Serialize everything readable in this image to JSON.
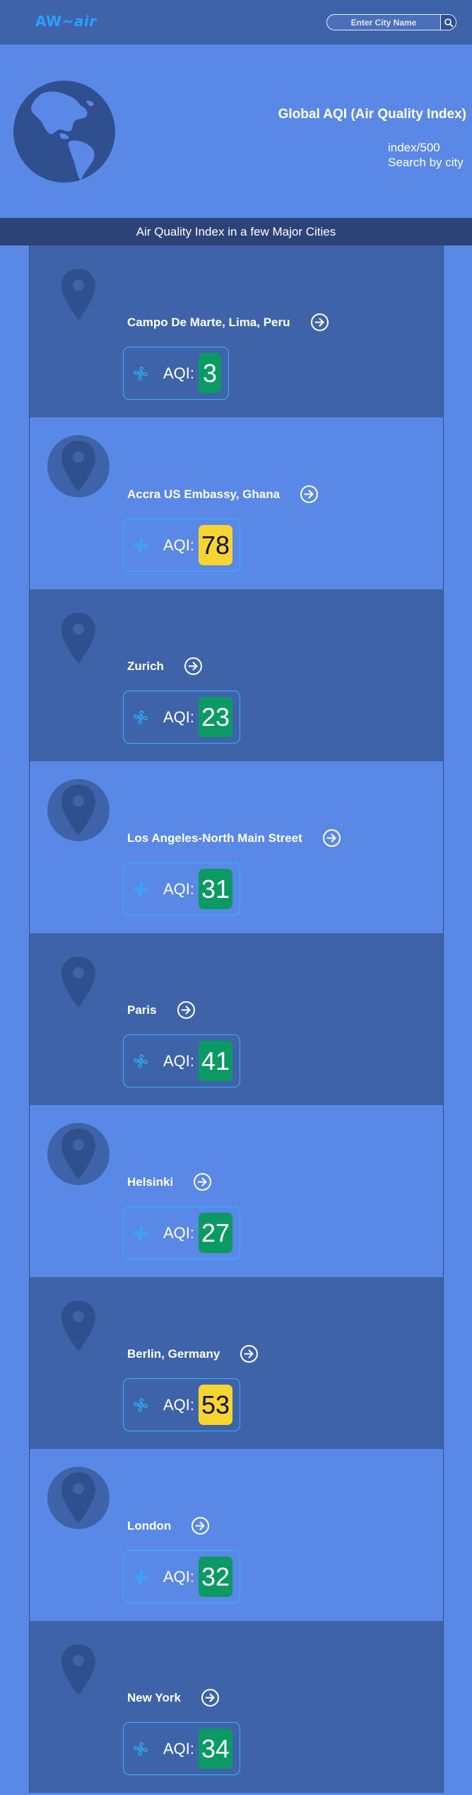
{
  "header": {
    "logo_main": "AW~",
    "logo_accent": "air",
    "search_placeholder": "Enter City Name",
    "search_icon": "search-icon"
  },
  "hero": {
    "title": "Global AQI (Air Quality Index)",
    "line1": "index/500",
    "line2": "Search by city",
    "globe_icon": "globe-americas-icon"
  },
  "section": {
    "title": "Air Quality Index in a few Major Cities"
  },
  "colors": {
    "background": "#5a88e6",
    "dark_band": "#3f63a9",
    "section_bar": "#2c4377",
    "aqi_good": "#0b9a63",
    "aqi_moderate": "#f7d530",
    "accent": "#2cb6ff"
  },
  "aqi_label": "AQI:",
  "cities": [
    {
      "name": "Campo De Marte, Lima, Peru",
      "aqi": "3"
    },
    {
      "name": "Accra US Embassy, Ghana",
      "aqi": "78"
    },
    {
      "name": "Zurich",
      "aqi": "23"
    },
    {
      "name": "Los Angeles-North Main Street",
      "aqi": "31"
    },
    {
      "name": "Paris",
      "aqi": "41"
    },
    {
      "name": "Helsinki",
      "aqi": "27"
    },
    {
      "name": "Berlin, Germany",
      "aqi": "53"
    },
    {
      "name": "London",
      "aqi": "32"
    },
    {
      "name": "New York",
      "aqi": "34"
    }
  ]
}
